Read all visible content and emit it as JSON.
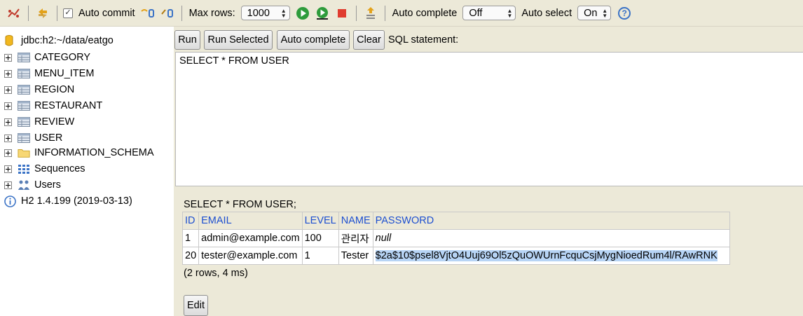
{
  "toolbar": {
    "auto_commit_label": "Auto commit",
    "auto_commit_checked": true,
    "max_rows_label": "Max rows:",
    "max_rows_value": "1000",
    "auto_complete_label": "Auto complete",
    "auto_complete_value": "Off",
    "auto_select_label": "Auto select",
    "auto_select_value": "On",
    "help_glyph": "?"
  },
  "tree": {
    "connection": "jdbc:h2:~/data/eatgo",
    "tables": [
      "CATEGORY",
      "MENU_ITEM",
      "REGION",
      "RESTAURANT",
      "REVIEW",
      "USER"
    ],
    "schema": "INFORMATION_SCHEMA",
    "sequences": "Sequences",
    "users": "Users",
    "version": "H2 1.4.199 (2019-03-13)"
  },
  "buttons": {
    "run": "Run",
    "run_selected": "Run Selected",
    "auto_complete": "Auto complete",
    "clear": "Clear",
    "edit": "Edit"
  },
  "sql_label": "SQL statement:",
  "sql_text": "SELECT * FROM USER",
  "result": {
    "command": "SELECT * FROM USER;",
    "columns": [
      "ID",
      "EMAIL",
      "LEVEL",
      "NAME",
      "PASSWORD"
    ],
    "rows": [
      [
        "1",
        "admin@example.com",
        "100",
        "관리자",
        "null"
      ],
      [
        "20",
        "tester@example.com",
        "1",
        "Tester",
        "$2a$10$psel8VjtO4Uuj69Ol5zQuOWUrnFcquCsjMygNioedRum4l/RAwRNK"
      ]
    ],
    "summary": "(2 rows, 4 ms)"
  },
  "colors": {
    "panel_bg": "#ece9d8",
    "header_text": "#1d4fd0",
    "selection": "#b7d4f5"
  }
}
